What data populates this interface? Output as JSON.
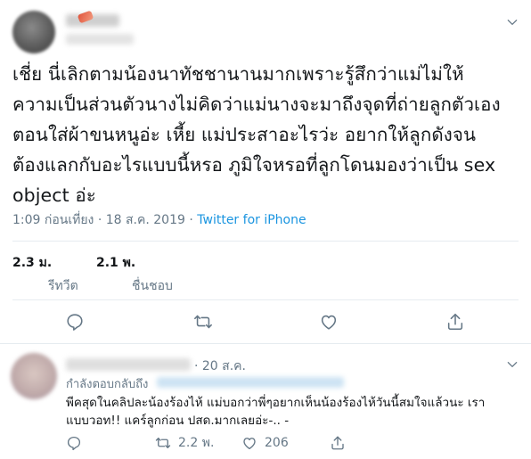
{
  "tweet": {
    "body_lines": [
      "เชี่ย นี่เลิกตามน้องนาทัชชานานมากเพราะรู้สึกว่าแม่ไม่ให้",
      "ความเป็นส่วนตัวนางไม่คิดว่าแม่นางจะมาถึงจุดที่ถ่ายลูกตัวเอง",
      "ตอนใส่ผ้าขนหนูอ่ะ เหี้ย แม่ประสาอะไรว่ะ อยากให้ลูกดังจน",
      "ต้องแลกกับอะไรแบบนี้หรอ ภูมิใจหรอที่ลูกโดนมองว่าเป็น sex",
      "object อ่ะ"
    ],
    "timestamp": "1:09 ก่อนเที่ยง · 18 ส.ค. 2019 · ",
    "source": "Twitter for iPhone",
    "retweets": {
      "count": "2.3 ม.",
      "label": "รีทวีต"
    },
    "likes": {
      "count": "2.1 พ.",
      "label": "ชื่นชอบ"
    }
  },
  "icons": {
    "menu": "chevron-down-icon",
    "reply": "reply-icon",
    "retweet": "retweet-icon",
    "like": "heart-icon",
    "share": "share-icon"
  },
  "reply": {
    "time": "· 20 ส.ค.",
    "replying_to_label": "กำลังตอบกลับถึง",
    "text_lines": [
      "พีคสุดในคลิปละน้องร้องไห้ แม่บอกว่าพี่ๆอยากเห็นน้องร้องไห้วันนี้สมใจแล้วนะ เรา",
      "แบบวอท!! แคร์ลูกก่อน ปสด.มากเลยอ่ะ-.. -"
    ],
    "retweets": "2.2 พ.",
    "likes": "206"
  },
  "colors": {
    "text": "#14171a",
    "muted": "#657786",
    "link": "#1b95e0",
    "divider": "#e6ecf0"
  }
}
